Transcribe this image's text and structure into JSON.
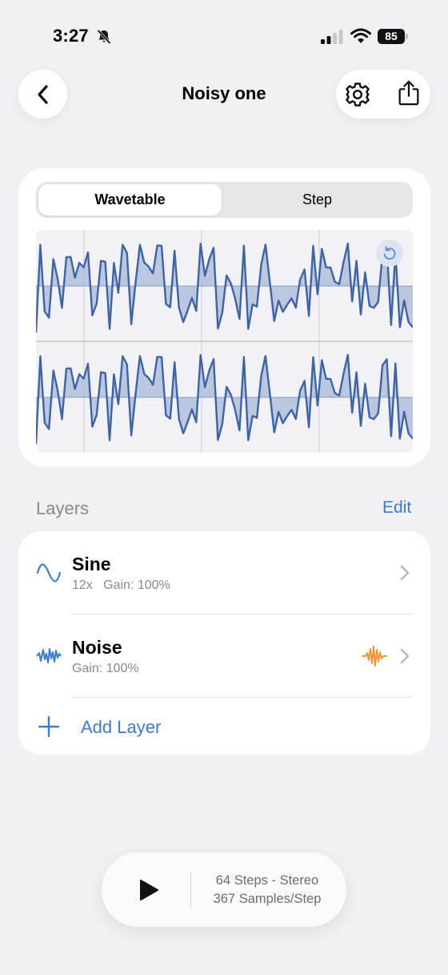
{
  "status": {
    "time": "3:27",
    "battery": "85",
    "icons": [
      "bell-slash-icon",
      "signal-icon",
      "wifi-icon",
      "battery-icon"
    ]
  },
  "nav": {
    "title": "Noisy one",
    "icons": [
      "chevron-left-icon",
      "gear-icon",
      "share-icon"
    ]
  },
  "segments": {
    "wavetable": "Wavetable",
    "step": "Step",
    "selected": "Wavetable"
  },
  "wave": {
    "reset_icon": "reset-icon",
    "stroke_color": "#3e64a8",
    "fill_color": "#a7b8d7"
  },
  "layers": {
    "title": "Layers",
    "edit": "Edit",
    "items": [
      {
        "name": "Sine",
        "count": "12x",
        "gain": "Gain: 100%",
        "icon": "sine-wave-icon"
      },
      {
        "name": "Noise",
        "gain": "Gain: 100%",
        "icon": "noise-wave-icon",
        "badge_icon": "noise-burst-icon"
      }
    ],
    "add_label": "Add Layer"
  },
  "player": {
    "line1": "64 Steps - Stereo",
    "line2": "367 Samples/Step",
    "play_icon": "play-icon"
  },
  "colors": {
    "accent": "#3a7bd5",
    "background": "#f1f1f5",
    "noise_badge": "#f0953a"
  }
}
